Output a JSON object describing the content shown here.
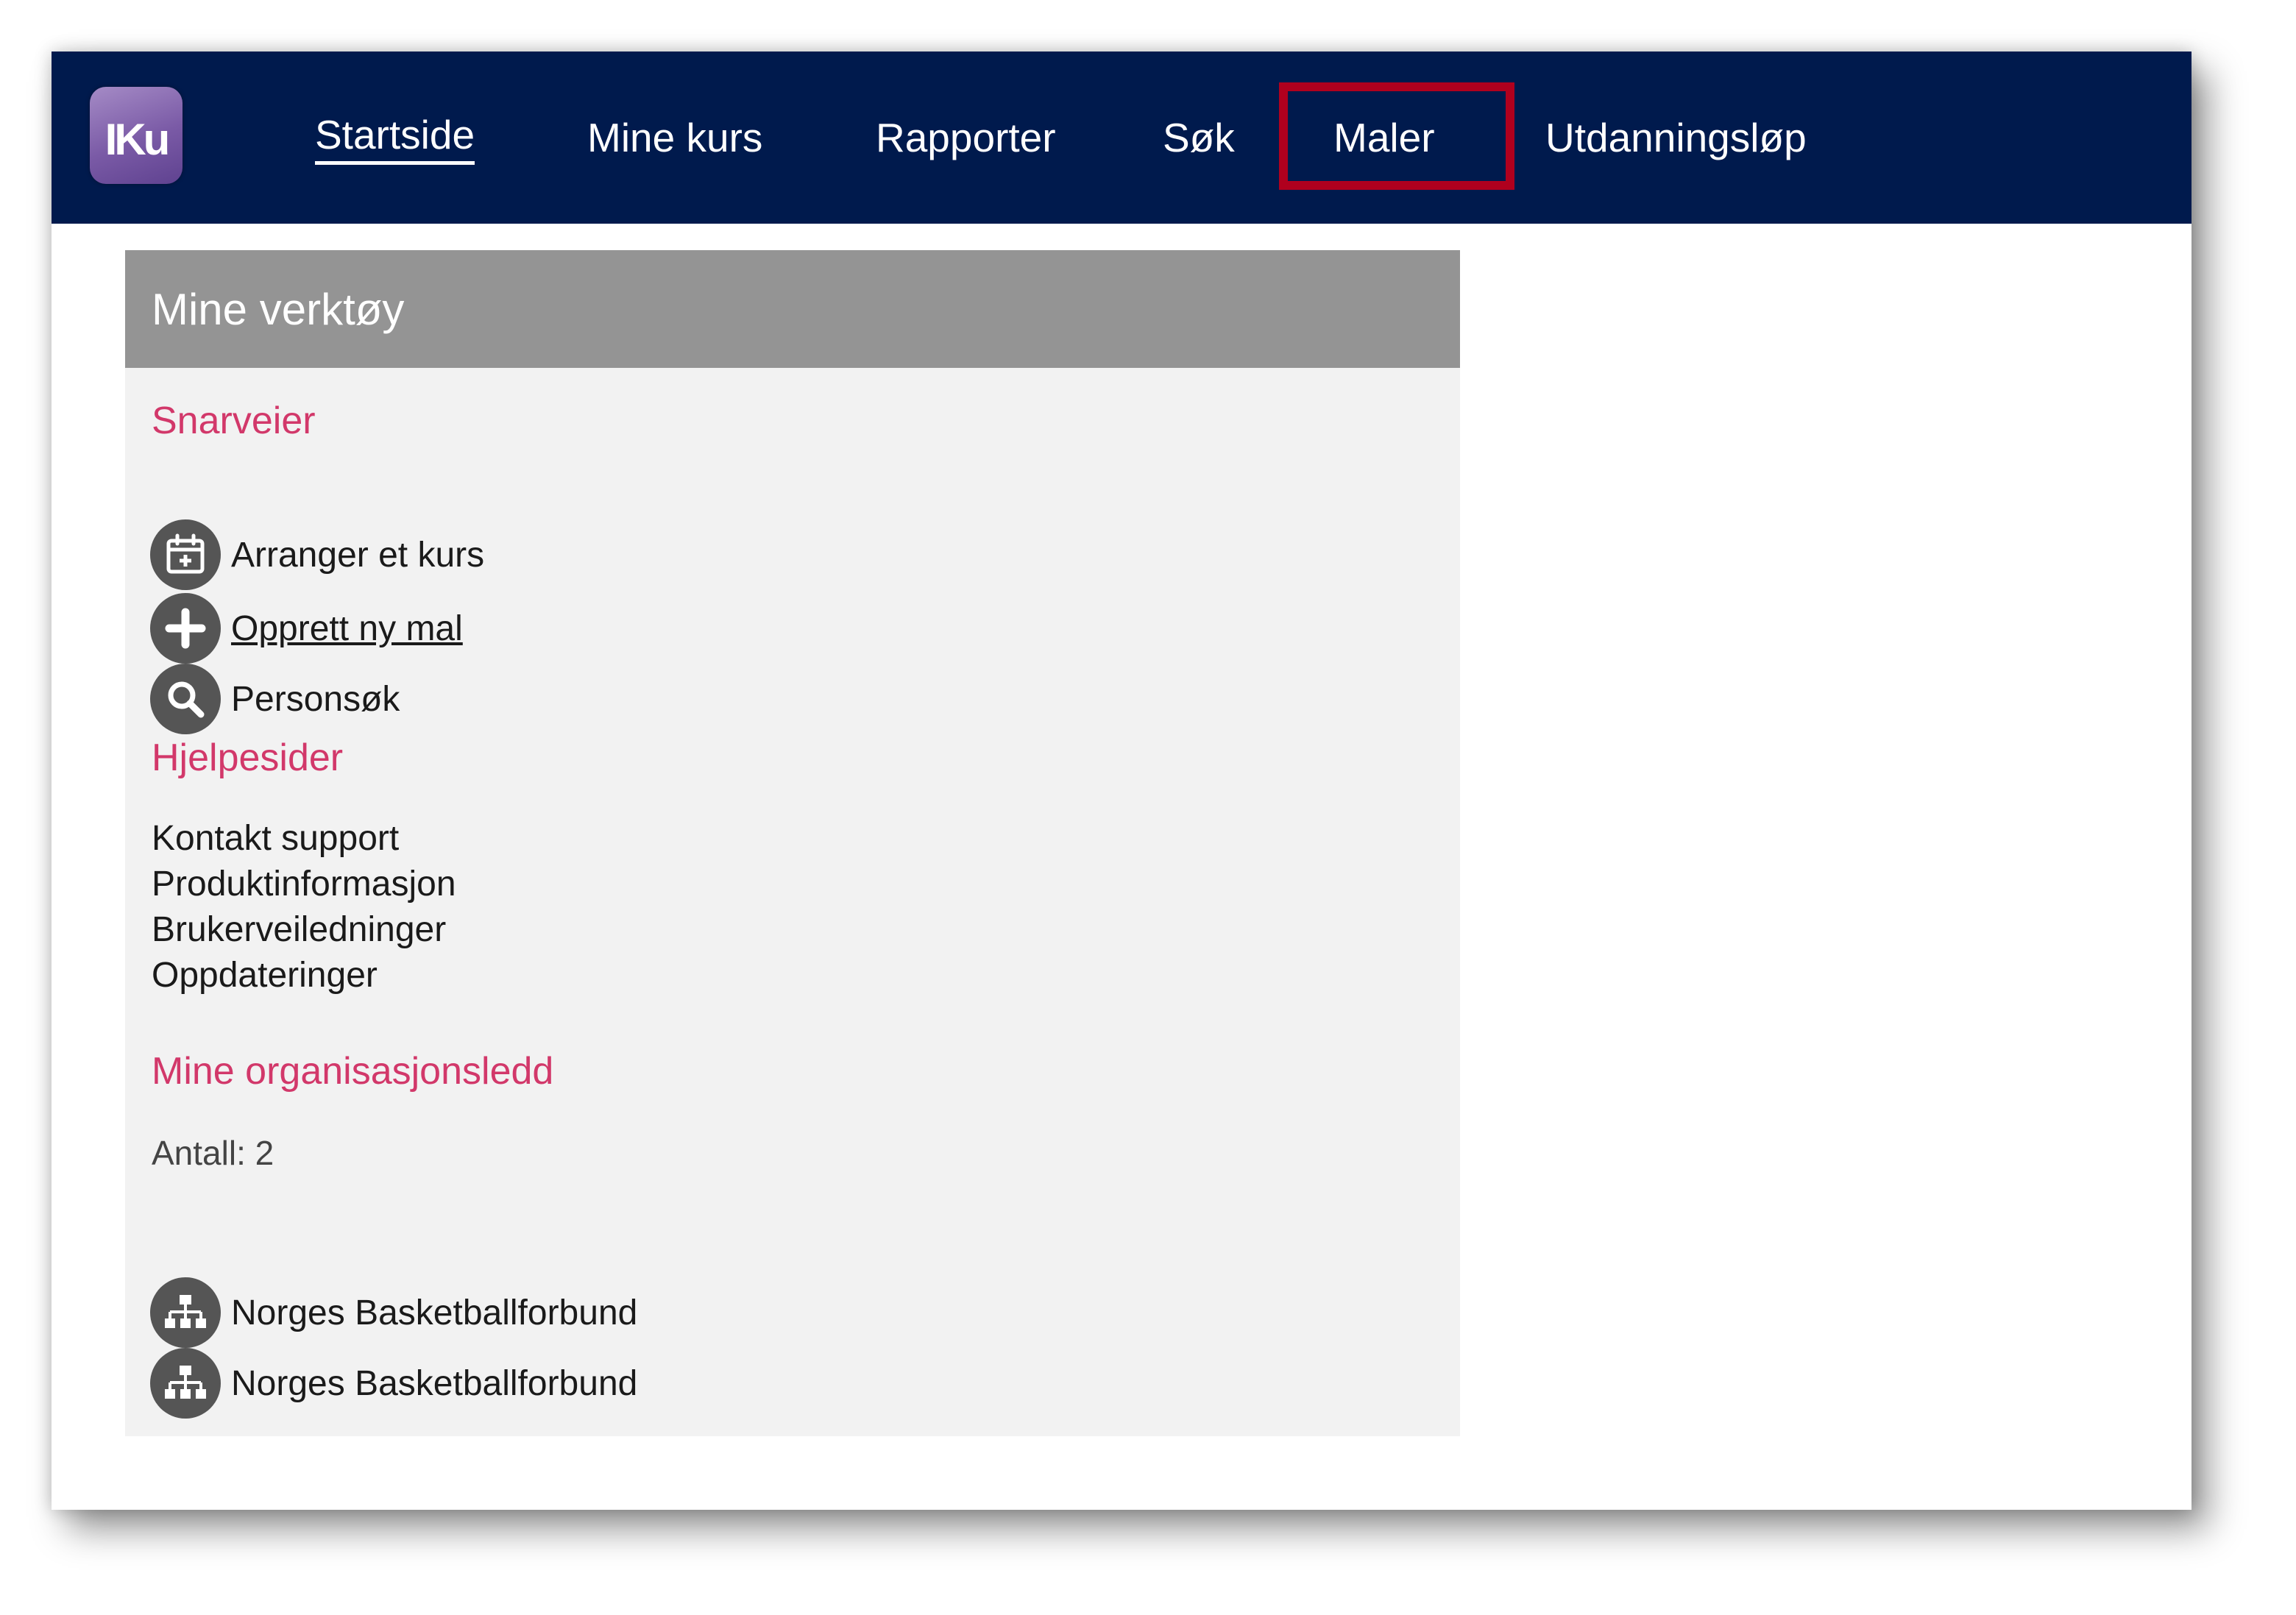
{
  "header": {
    "logo_text": "IKu",
    "nav": [
      {
        "label": "Startside"
      },
      {
        "label": "Mine kurs"
      },
      {
        "label": "Rapporter"
      },
      {
        "label": "Søk"
      },
      {
        "label": "Maler"
      },
      {
        "label": "Utdanningsløp"
      }
    ],
    "active_item": "Startside",
    "highlighted_item": "Maler"
  },
  "panel": {
    "title": "Mine verktøy",
    "shortcuts": {
      "heading": "Snarveier",
      "items": [
        {
          "label": "Arranger et kurs",
          "icon": "calendar-add-icon"
        },
        {
          "label": "Opprett ny mal",
          "icon": "plus-icon"
        },
        {
          "label": "Personsøk",
          "icon": "search-icon"
        }
      ]
    },
    "help": {
      "heading": "Hjelpesider",
      "links": [
        {
          "label": "Kontakt support"
        },
        {
          "label": "Produktinformasjon"
        },
        {
          "label": "Brukerveiledninger"
        },
        {
          "label": "Oppdateringer"
        }
      ]
    },
    "orgs": {
      "heading": "Mine organisasjonsledd",
      "count_label": "Antall: 2",
      "items": [
        {
          "label": "Norges Basketballforbund",
          "icon": "org-chart-icon"
        },
        {
          "label": "Norges Basketballforbund",
          "icon": "org-chart-icon"
        }
      ]
    }
  },
  "colors": {
    "header_bg": "#001a4d",
    "section_heading": "#d2386a",
    "highlight_border": "#b0001e",
    "panel_header_bg": "#949494",
    "panel_bg": "#f2f2f2"
  }
}
